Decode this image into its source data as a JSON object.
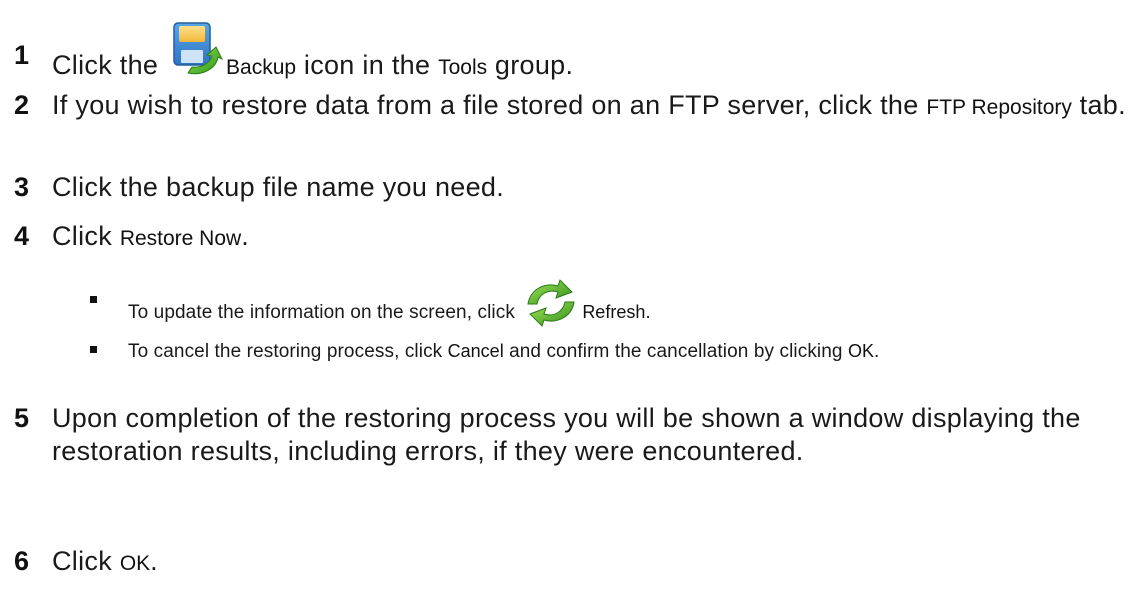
{
  "steps": [
    {
      "num": "1",
      "pre": "Click the ",
      "ui": "Backup",
      "post": " icon in the ",
      "ui2": "Tools",
      "post2": " group."
    },
    {
      "num": "2",
      "pre": "If you wish to restore data from a file stored on an FTP server, click the ",
      "ui": "FTP Repository",
      "post": " tab."
    },
    {
      "num": "3",
      "text": "Click the backup file name you need."
    },
    {
      "num": "4",
      "pre": "Click ",
      "ui": "Restore Now",
      "post": "."
    },
    {
      "num": "5",
      "text": "Upon completion of the restoring process you will be shown a window displaying the restoration results, including errors, if they were encountered."
    },
    {
      "num": "6",
      "pre": "Click ",
      "ui": "OK",
      "post": "."
    }
  ],
  "substeps": [
    {
      "pre": "To update the information on the screen, click ",
      "ui": "Refresh",
      "post": "."
    },
    {
      "pre": "To cancel the restoring process, click ",
      "ui": "Cancel",
      "mid": " and confirm the cancellation by clicking ",
      "ui2": "OK",
      "post": "."
    }
  ],
  "icons": {
    "backup": "backup-floppy-icon",
    "refresh": "refresh-arrows-icon"
  }
}
